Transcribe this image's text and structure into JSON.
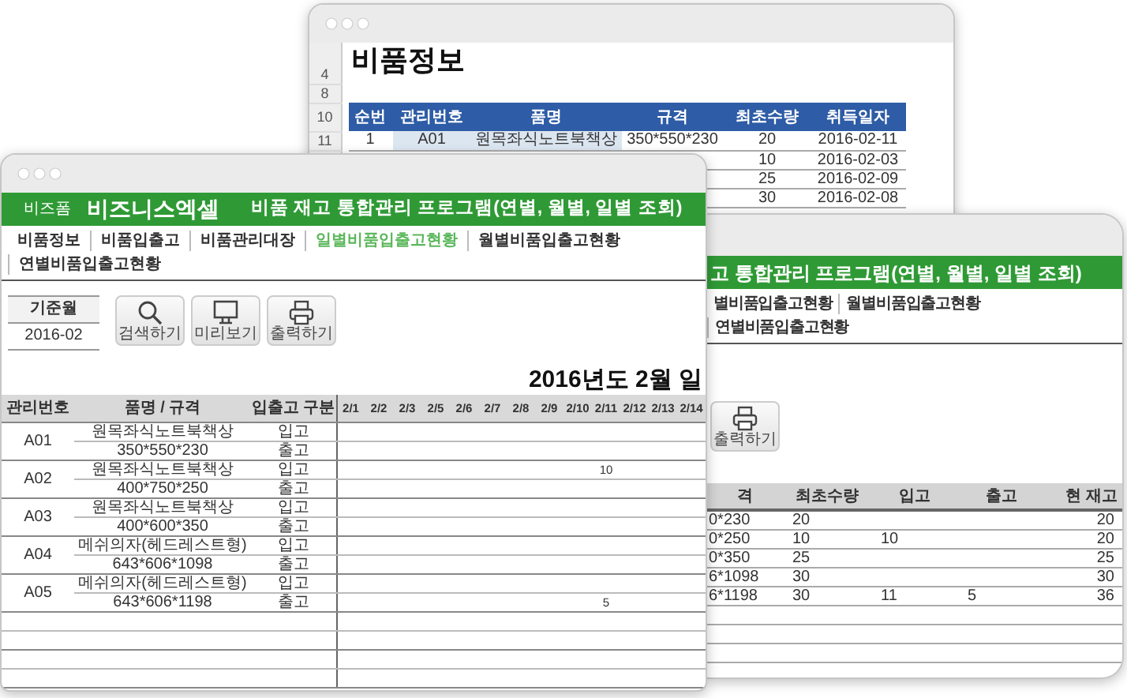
{
  "back_window": {
    "title": "비품정보",
    "row_numbers": [
      "4",
      "8",
      "10",
      "11"
    ],
    "table": {
      "columns": [
        "순번",
        "관리번호",
        "품명",
        "규격",
        "최초수량",
        "취득일자"
      ],
      "rows": [
        {
          "cells": [
            "1",
            "A01",
            "원목좌식노트북책상",
            "350*550*230",
            "20",
            "2016-02-11"
          ]
        },
        {
          "cells": [
            "10",
            "2016-02-03"
          ]
        },
        {
          "cells": [
            "25",
            "2016-02-09"
          ]
        },
        {
          "cells": [
            "30",
            "2016-02-08"
          ]
        }
      ]
    }
  },
  "right_window": {
    "title": "고 통합관리 프로그램(연별, 월별, 일별 조회)",
    "nav": [
      {
        "label": "별비품입출고현황",
        "selected": false
      },
      {
        "label": "월별비품입출고현황",
        "selected": false
      },
      {
        "label": "연별비품입출고현황",
        "selected": false
      }
    ],
    "print_button": {
      "label": "출력하기"
    },
    "table": {
      "columns": [
        "격",
        "최초수량",
        "입고",
        "출고",
        "현 재고"
      ],
      "rows": [
        {
          "spec": "0*230",
          "initial_qty": "20",
          "stock": "20"
        },
        {
          "spec": "0*250",
          "initial_qty": "10",
          "in_qty": "10",
          "stock": "20"
        },
        {
          "spec": "0*350",
          "initial_qty": "25",
          "stock": "25"
        },
        {
          "spec": "6*1098",
          "initial_qty": "30",
          "stock": "30"
        },
        {
          "spec": "6*1198",
          "initial_qty": "30",
          "in_qty": "11",
          "out_qty": "5",
          "stock": "36"
        }
      ]
    }
  },
  "front_window": {
    "brand_small": "비즈폼",
    "brand": "비즈니스엑셀",
    "title": "비품 재고 통합관리 프로그램(연별, 월별, 일별 조회)",
    "nav": [
      {
        "label": "비품정보",
        "selected": false
      },
      {
        "label": "비품입출고",
        "selected": false
      },
      {
        "label": "비품관리대장",
        "selected": false
      },
      {
        "label": "일별비품입출고현황",
        "selected": true
      },
      {
        "label": "월별비품입출고현황",
        "selected": false
      },
      {
        "label": "연별비품입출고현황",
        "selected": false
      }
    ],
    "base_month": {
      "label": "기준월",
      "value": "2016-02"
    },
    "toolbar": [
      {
        "kind": "search",
        "label": "검색하기"
      },
      {
        "kind": "preview",
        "label": "미리보기"
      },
      {
        "kind": "print",
        "label": "출력하기"
      }
    ],
    "heading": "2016년도 2월 일",
    "table": {
      "columns": [
        "관리번호",
        "품명 / 규격",
        "입출고 구분"
      ],
      "dates": [
        "2/1",
        "2/2",
        "2/3",
        "2/5",
        "2/6",
        "2/7",
        "2/8",
        "2/9",
        "2/10",
        "2/11",
        "2/12",
        "2/13",
        "2/14"
      ],
      "items": [
        {
          "id": "A01",
          "name": "원목좌식노트북책상",
          "spec": "350*550*230",
          "in_label": "입고",
          "out_label": "출고",
          "in_values": [
            {
              "kind": "empty"
            },
            {
              "kind": "empty"
            },
            {
              "kind": "empty"
            },
            {
              "kind": "empty"
            },
            {
              "kind": "empty"
            },
            {
              "kind": "empty"
            },
            {
              "kind": "empty"
            },
            {
              "kind": "empty"
            },
            {
              "kind": "empty"
            },
            {
              "kind": "empty"
            },
            {
              "kind": "empty"
            },
            {
              "kind": "empty"
            },
            {
              "kind": "empty"
            }
          ],
          "out_values": [
            {
              "kind": "empty"
            },
            {
              "kind": "empty"
            },
            {
              "kind": "empty"
            },
            {
              "kind": "empty"
            },
            {
              "kind": "empty"
            },
            {
              "kind": "empty"
            },
            {
              "kind": "empty"
            },
            {
              "kind": "empty"
            },
            {
              "kind": "empty"
            },
            {
              "kind": "empty"
            },
            {
              "kind": "empty"
            },
            {
              "kind": "empty"
            },
            {
              "kind": "empty"
            }
          ]
        },
        {
          "id": "A02",
          "name": "원목좌식노트북책상",
          "spec": "400*750*250",
          "in_label": "입고",
          "out_label": "출고",
          "in_values": [
            {
              "kind": "empty"
            },
            {
              "kind": "empty"
            },
            {
              "kind": "empty"
            },
            {
              "kind": "empty"
            },
            {
              "kind": "empty"
            },
            {
              "kind": "empty"
            },
            {
              "kind": "empty"
            },
            {
              "kind": "empty"
            },
            {
              "kind": "empty"
            },
            {
              "kind": "qty",
              "text": "10"
            },
            {
              "kind": "empty"
            },
            {
              "kind": "empty"
            },
            {
              "kind": "empty"
            }
          ],
          "out_values": [
            {
              "kind": "empty"
            },
            {
              "kind": "empty"
            },
            {
              "kind": "empty"
            },
            {
              "kind": "empty"
            },
            {
              "kind": "empty"
            },
            {
              "kind": "empty"
            },
            {
              "kind": "empty"
            },
            {
              "kind": "empty"
            },
            {
              "kind": "empty"
            },
            {
              "kind": "empty"
            },
            {
              "kind": "empty"
            },
            {
              "kind": "empty"
            },
            {
              "kind": "empty"
            }
          ]
        },
        {
          "id": "A03",
          "name": "원목좌식노트북책상",
          "spec": "400*600*350",
          "in_label": "입고",
          "out_label": "출고",
          "in_values": [
            {
              "kind": "empty"
            },
            {
              "kind": "empty"
            },
            {
              "kind": "empty"
            },
            {
              "kind": "empty"
            },
            {
              "kind": "empty"
            },
            {
              "kind": "empty"
            },
            {
              "kind": "empty"
            },
            {
              "kind": "empty"
            },
            {
              "kind": "empty"
            },
            {
              "kind": "empty"
            },
            {
              "kind": "empty"
            },
            {
              "kind": "empty"
            },
            {
              "kind": "empty"
            }
          ],
          "out_values": [
            {
              "kind": "empty"
            },
            {
              "kind": "empty"
            },
            {
              "kind": "empty"
            },
            {
              "kind": "empty"
            },
            {
              "kind": "empty"
            },
            {
              "kind": "empty"
            },
            {
              "kind": "empty"
            },
            {
              "kind": "empty"
            },
            {
              "kind": "empty"
            },
            {
              "kind": "empty"
            },
            {
              "kind": "empty"
            },
            {
              "kind": "empty"
            },
            {
              "kind": "empty"
            }
          ]
        },
        {
          "id": "A04",
          "name": "메쉬의자(헤드레스트형)",
          "spec": "643*606*1098",
          "in_label": "입고",
          "out_label": "출고",
          "in_values": [
            {
              "kind": "empty"
            },
            {
              "kind": "empty"
            },
            {
              "kind": "empty"
            },
            {
              "kind": "empty"
            },
            {
              "kind": "empty"
            },
            {
              "kind": "empty"
            },
            {
              "kind": "empty"
            },
            {
              "kind": "empty"
            },
            {
              "kind": "empty"
            },
            {
              "kind": "empty"
            },
            {
              "kind": "empty"
            },
            {
              "kind": "empty"
            },
            {
              "kind": "empty"
            }
          ],
          "out_values": [
            {
              "kind": "empty"
            },
            {
              "kind": "empty"
            },
            {
              "kind": "empty"
            },
            {
              "kind": "empty"
            },
            {
              "kind": "empty"
            },
            {
              "kind": "empty"
            },
            {
              "kind": "empty"
            },
            {
              "kind": "empty"
            },
            {
              "kind": "empty"
            },
            {
              "kind": "empty"
            },
            {
              "kind": "empty"
            },
            {
              "kind": "empty"
            },
            {
              "kind": "empty"
            }
          ]
        },
        {
          "id": "A05",
          "name": "메쉬의자(헤드레스트형)",
          "spec": "643*606*1198",
          "in_label": "입고",
          "out_label": "출고",
          "in_values": [
            {
              "kind": "empty"
            },
            {
              "kind": "empty"
            },
            {
              "kind": "empty"
            },
            {
              "kind": "empty"
            },
            {
              "kind": "empty"
            },
            {
              "kind": "empty"
            },
            {
              "kind": "empty"
            },
            {
              "kind": "empty"
            },
            {
              "kind": "empty"
            },
            {
              "kind": "empty"
            },
            {
              "kind": "empty"
            },
            {
              "kind": "empty"
            },
            {
              "kind": "empty"
            }
          ],
          "out_values": [
            {
              "kind": "empty"
            },
            {
              "kind": "empty"
            },
            {
              "kind": "empty"
            },
            {
              "kind": "empty"
            },
            {
              "kind": "empty"
            },
            {
              "kind": "empty"
            },
            {
              "kind": "empty"
            },
            {
              "kind": "empty"
            },
            {
              "kind": "empty"
            },
            {
              "kind": "qty",
              "text": "5"
            },
            {
              "kind": "empty"
            },
            {
              "kind": "empty"
            },
            {
              "kind": "empty"
            }
          ]
        }
      ]
    }
  }
}
